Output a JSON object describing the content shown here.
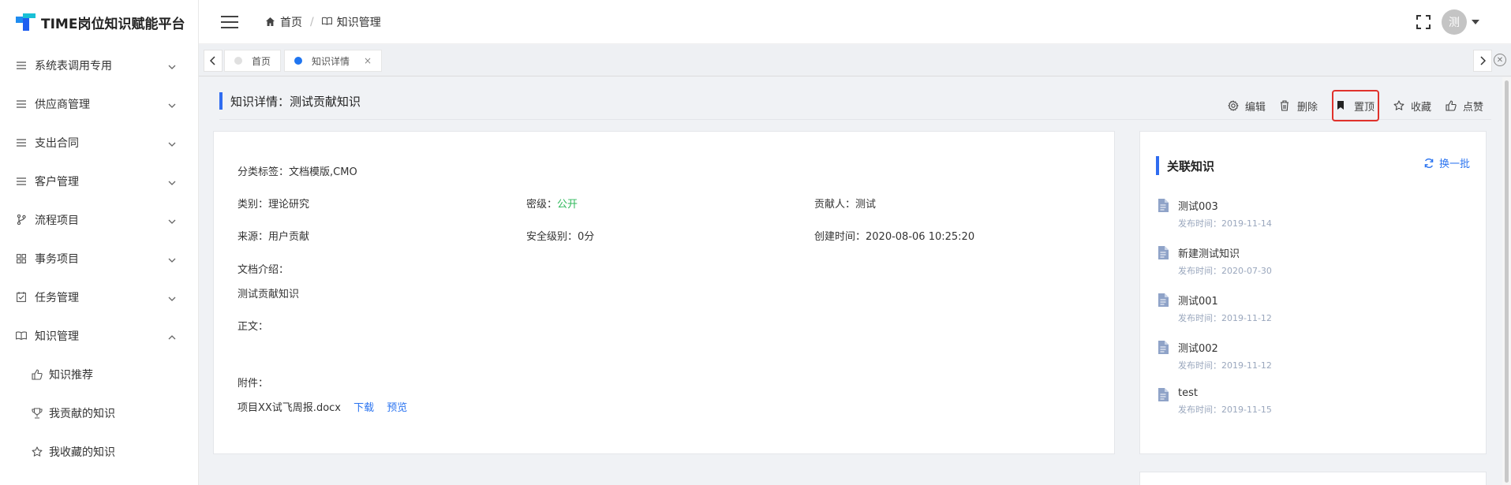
{
  "app": {
    "title": "TIME岗位知识赋能平台"
  },
  "sidebar": {
    "items": [
      {
        "label": "系统表调用专用",
        "icon": "list-icon"
      },
      {
        "label": "供应商管理",
        "icon": "list-icon"
      },
      {
        "label": "支出合同",
        "icon": "list-icon"
      },
      {
        "label": "客户管理",
        "icon": "list-icon"
      },
      {
        "label": "流程项目",
        "icon": "branch-icon"
      },
      {
        "label": "事务项目",
        "icon": "grid-icon"
      },
      {
        "label": "任务管理",
        "icon": "checkbox-icon"
      },
      {
        "label": "知识管理",
        "icon": "book-icon",
        "expanded": true
      }
    ],
    "sub_items": [
      {
        "label": "知识推荐",
        "icon": "thumbs-up-icon"
      },
      {
        "label": "我贡献的知识",
        "icon": "trophy-icon"
      },
      {
        "label": "我收藏的知识",
        "icon": "star-icon"
      }
    ]
  },
  "header": {
    "breadcrumb": [
      {
        "label": "首页",
        "icon": "home-icon"
      },
      {
        "label": "知识管理",
        "icon": "book-icon"
      }
    ],
    "avatar_text": "测"
  },
  "tabs": [
    {
      "label": "首页",
      "active": false
    },
    {
      "label": "知识详情",
      "active": true,
      "close": "×"
    }
  ],
  "page": {
    "title": "知识详情：测试贡献知识",
    "actions": [
      {
        "label": "编辑",
        "icon": "gear-icon"
      },
      {
        "label": "删除",
        "icon": "trash-icon"
      },
      {
        "label": "置顶",
        "icon": "bookmark-icon",
        "highlighted": true
      },
      {
        "label": "收藏",
        "icon": "star-icon"
      },
      {
        "label": "点赞",
        "icon": "thumbs-up-icon"
      }
    ]
  },
  "detail": {
    "tags_label": "分类标签：",
    "tags_value": "文档模版,CMO",
    "category_label": "类别：",
    "category_value": "理论研究",
    "secret_label": "密级：",
    "secret_value": "公开",
    "contributor_label": "贡献人：",
    "contributor_value": "测试",
    "source_label": "来源：",
    "source_value": "用户贡献",
    "security_label": "安全级别：",
    "security_value": "0分",
    "created_label": "创建时间：",
    "created_value": "2020-08-06 10:25:20",
    "intro_label": "文档介绍：",
    "intro_value": "测试贡献知识",
    "body_label": "正文：",
    "attach_label": "附件：",
    "attach_file": "项目XX试飞周报.docx",
    "download": "下载",
    "preview": "预览"
  },
  "related": {
    "title": "关联知识",
    "refresh": "换一批",
    "items": [
      {
        "title": "测试003",
        "date": "发布时间：2019-11-14"
      },
      {
        "title": "新建测试知识",
        "date": "发布时间：2020-07-30"
      },
      {
        "title": "测试001",
        "date": "发布时间：2019-11-12"
      },
      {
        "title": "测试002",
        "date": "发布时间：2019-11-12"
      },
      {
        "title": "test",
        "date": "发布时间：2019-11-15"
      }
    ]
  },
  "colors": {
    "accent": "#2f6cf0",
    "link": "#2b74f0",
    "green": "#2fb85b",
    "highlight_border": "#e0322c"
  }
}
